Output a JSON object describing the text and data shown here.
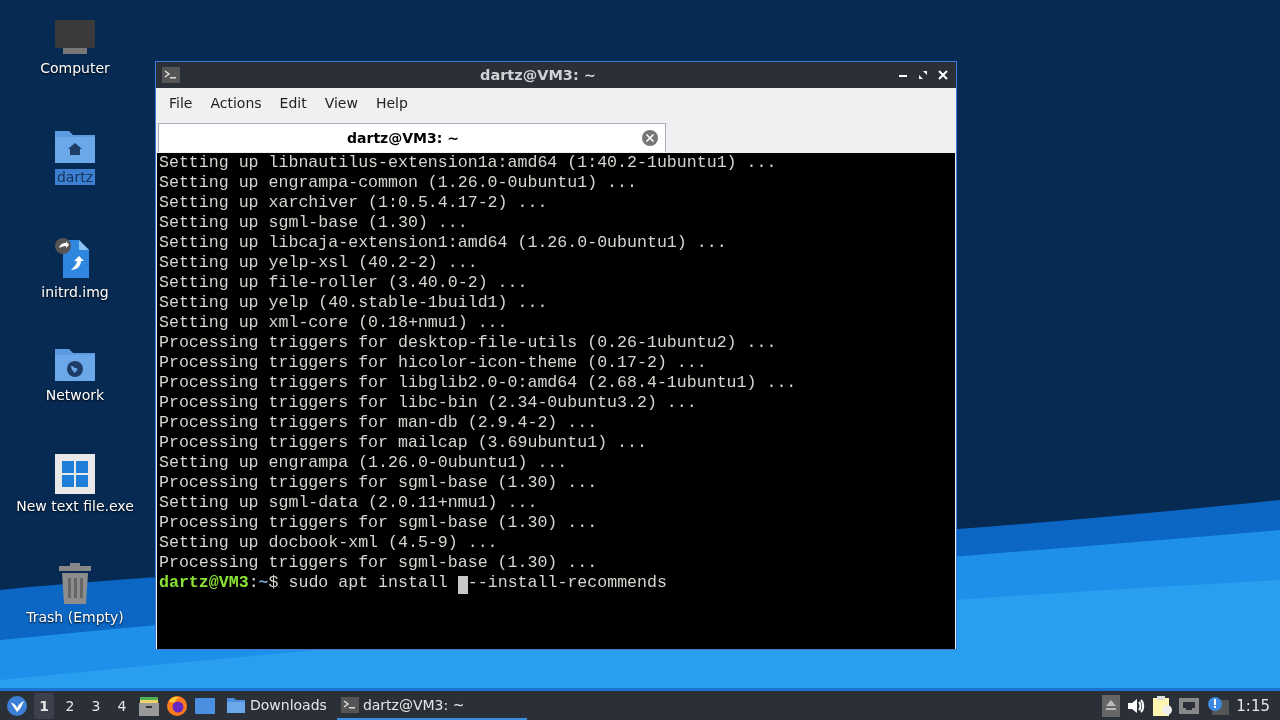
{
  "desktop": {
    "icons": [
      {
        "label": "Computer",
        "kind": "computer",
        "selected": false
      },
      {
        "label": "dartz",
        "kind": "home",
        "selected": true
      },
      {
        "label": "initrd.img",
        "kind": "link",
        "selected": false
      },
      {
        "label": "Network",
        "kind": "network",
        "selected": false
      },
      {
        "label": "New text file.exe",
        "kind": "windows",
        "selected": false
      },
      {
        "label": "Trash (Empty)",
        "kind": "trash",
        "selected": false
      }
    ]
  },
  "terminal_window": {
    "title": "dartz@VM3: ~",
    "menu": [
      "File",
      "Actions",
      "Edit",
      "View",
      "Help"
    ],
    "tabs": [
      {
        "label": "dartz@VM3: ~",
        "selected": true
      }
    ],
    "lines": [
      "Setting up libnautilus-extension1a:amd64 (1:40.2-1ubuntu1) ...",
      "Setting up engrampa-common (1.26.0-0ubuntu1) ...",
      "Setting up xarchiver (1:0.5.4.17-2) ...",
      "Setting up sgml-base (1.30) ...",
      "Setting up libcaja-extension1:amd64 (1.26.0-0ubuntu1) ...",
      "Setting up yelp-xsl (40.2-2) ...",
      "Setting up file-roller (3.40.0-2) ...",
      "Setting up yelp (40.stable-1build1) ...",
      "Setting up xml-core (0.18+nmu1) ...",
      "Processing triggers for desktop-file-utils (0.26-1ubuntu2) ...",
      "Processing triggers for hicolor-icon-theme (0.17-2) ...",
      "Processing triggers for libglib2.0-0:amd64 (2.68.4-1ubuntu1) ...",
      "Processing triggers for libc-bin (2.34-0ubuntu3.2) ...",
      "Processing triggers for man-db (2.9.4-2) ...",
      "Processing triggers for mailcap (3.69ubuntu1) ...",
      "Setting up engrampa (1.26.0-0ubuntu1) ...",
      "Processing triggers for sgml-base (1.30) ...",
      "Setting up sgml-data (2.0.11+nmu1) ...",
      "Processing triggers for sgml-base (1.30) ...",
      "Setting up docbook-xml (4.5-9) ...",
      "Processing triggers for sgml-base (1.30) ..."
    ],
    "prompt": {
      "user_host": "dartz@VM3",
      "separator": ":",
      "path": "~",
      "symbol": "$",
      "command": "sudo apt install ",
      "after_cursor": "--install-recommends"
    }
  },
  "taskbar": {
    "workspaces": [
      {
        "label": "1",
        "selected": true
      },
      {
        "label": "2",
        "selected": false
      },
      {
        "label": "3",
        "selected": false
      },
      {
        "label": "4",
        "selected": false
      }
    ],
    "launchers": [
      {
        "kind": "files"
      },
      {
        "kind": "browser"
      },
      {
        "kind": "desktop"
      }
    ],
    "tasks": [
      {
        "label": "Downloads",
        "kind": "folder",
        "selected": false
      },
      {
        "label": "dartz@VM3: ~",
        "kind": "terminal",
        "selected": true
      }
    ],
    "tray": [
      {
        "kind": "eject"
      },
      {
        "kind": "volume"
      },
      {
        "kind": "clipboard"
      },
      {
        "kind": "network"
      },
      {
        "kind": "notification"
      }
    ],
    "clock": "1:15"
  }
}
